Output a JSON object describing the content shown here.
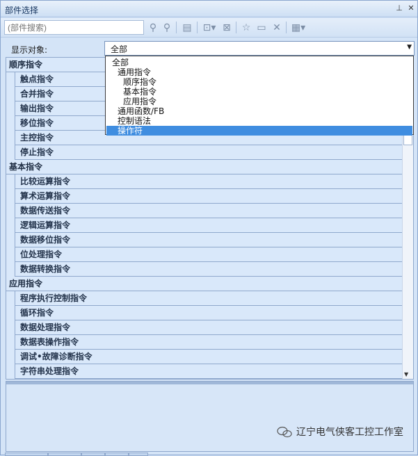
{
  "window": {
    "title": "部件选择"
  },
  "search": {
    "placeholder": "(部件搜索)"
  },
  "toolbar": {
    "icons": [
      "find-icon",
      "find-next-icon",
      "insert-icon",
      "dock-icon",
      "close-doc-icon",
      "favorite-icon",
      "folder-icon",
      "delete-icon",
      "view-icon"
    ]
  },
  "filter": {
    "label": "显示对象:",
    "selected": "全部",
    "options": [
      {
        "label": "全部",
        "level": 0
      },
      {
        "label": "通用指令",
        "level": 1
      },
      {
        "label": "顺序指令",
        "level": 2
      },
      {
        "label": "基本指令",
        "level": 2
      },
      {
        "label": "应用指令",
        "level": 2
      },
      {
        "label": "通用函数/FB",
        "level": 1
      },
      {
        "label": "控制语法",
        "level": 1
      },
      {
        "label": "操作符",
        "level": 1,
        "highlighted": true
      }
    ]
  },
  "tree": {
    "groups": [
      {
        "label": "顺序指令",
        "items": [
          "触点指令",
          "合并指令",
          "输出指令",
          "移位指令",
          "主控指令",
          "停止指令"
        ]
      },
      {
        "label": "基本指令",
        "items": [
          "比较运算指令",
          "算术运算指令",
          "数据传送指令",
          "逻辑运算指令",
          "数据移位指令",
          "位处理指令",
          "数据转换指令"
        ]
      },
      {
        "label": "应用指令",
        "items": [
          "程序执行控制指令",
          "循环指令",
          "数据处理指令",
          "数据表操作指令",
          "调试•故障诊断指令",
          "字符串处理指令"
        ]
      }
    ]
  },
  "watermark": {
    "text": "辽宁电气侠客工控工作室"
  },
  "colors": {
    "accent": "#3f8de0",
    "row_bg": "#d9e8fa",
    "panel_bg": "#d4e4f7"
  }
}
